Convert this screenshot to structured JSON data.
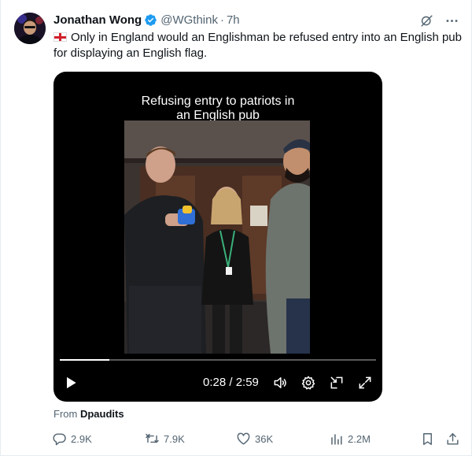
{
  "tweet": {
    "author_name": "Jonathan Wong",
    "handle": "@WGthink",
    "separator": "·",
    "time": "7h",
    "text": "Only in England would an Englishman be refused entry into an English pub for displaying an English flag.",
    "flag_icon": "england-flag-emoji"
  },
  "video": {
    "caption_line1": "Refusing entry to patriots in",
    "caption_line2": "an English pub",
    "timecode": "0:28 / 2:59",
    "progress_fraction": 0.156
  },
  "attribution": {
    "prefix": "From",
    "source": "Dpaudits"
  },
  "actions": {
    "replies": "2.9K",
    "reposts": "7.9K",
    "likes": "36K",
    "views": "2.2M"
  },
  "colors": {
    "verified": "#1d9bf0",
    "muted": "#536471",
    "text": "#0f1419"
  }
}
